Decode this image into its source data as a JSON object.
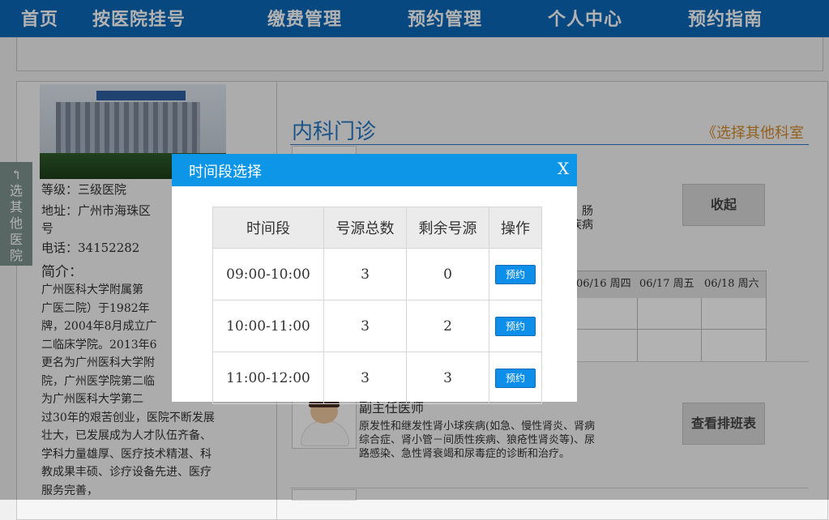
{
  "nav": {
    "items": [
      "首页",
      "按医院挂号",
      "缴费管理",
      "预约管理",
      "个人中心",
      "预约指南"
    ]
  },
  "hospital": {
    "level": "等级：三级医院",
    "address_line1": "地址：广州市海珠区",
    "address_line2": "号",
    "phone": "电话：34152282",
    "intro_title": "简介：",
    "intro_lines": [
      "广州医科大学附属第",
      "广医二院）于1982年",
      "牌，2004年8月成立广",
      "二临床学院。2013年6",
      "更名为广州医科大学附",
      "院，广州医学院第二临",
      "为广州医科大学第二",
      "过30年的艰苦创业，医院不断发展",
      "壮大，已发展成为人才队伍齐备、",
      "学科力量雄厚、医疗技术精湛、科",
      "教成果丰硕、诊疗设备先进、医疗",
      "服务完善，"
    ]
  },
  "side_tab": {
    "chars": [
      "↰",
      "选",
      "其",
      "他",
      "医",
      "院"
    ]
  },
  "department": {
    "title": "内科门诊",
    "other_link": "《选择其他科室"
  },
  "doctor1": {
    "spec_line1": "、肠",
    "spec_line2": "疾病",
    "collapse_button": "收起",
    "schedule_headers": [
      "06/16 周四",
      "06/17 周五",
      "06/18 周六"
    ]
  },
  "doctor2": {
    "title": "副主任医师",
    "desc": "原发性和继发性肾小球疾病(如急、慢性肾炎、肾病综合症、肾小管－间质性疾病、狼疮性肾炎等)、尿路感染、急性肾衰竭和尿毒症的诊断和治疗。",
    "schedule_button": "查看排班表"
  },
  "modal": {
    "title": "时间段选择",
    "close": "X",
    "headers": [
      "时间段",
      "号源总数",
      "剩余号源",
      "操作"
    ],
    "rows": [
      {
        "time": "09:00-10:00",
        "total": "3",
        "remaining": "0",
        "action": "预约"
      },
      {
        "time": "10:00-11:00",
        "total": "3",
        "remaining": "2",
        "action": "预约"
      },
      {
        "time": "11:00-12:00",
        "total": "3",
        "remaining": "3",
        "action": "预约"
      }
    ]
  },
  "colors": {
    "nav": "#0a67b7",
    "modal_header": "#0d95e8",
    "accent_orange": "#d58a2c"
  }
}
